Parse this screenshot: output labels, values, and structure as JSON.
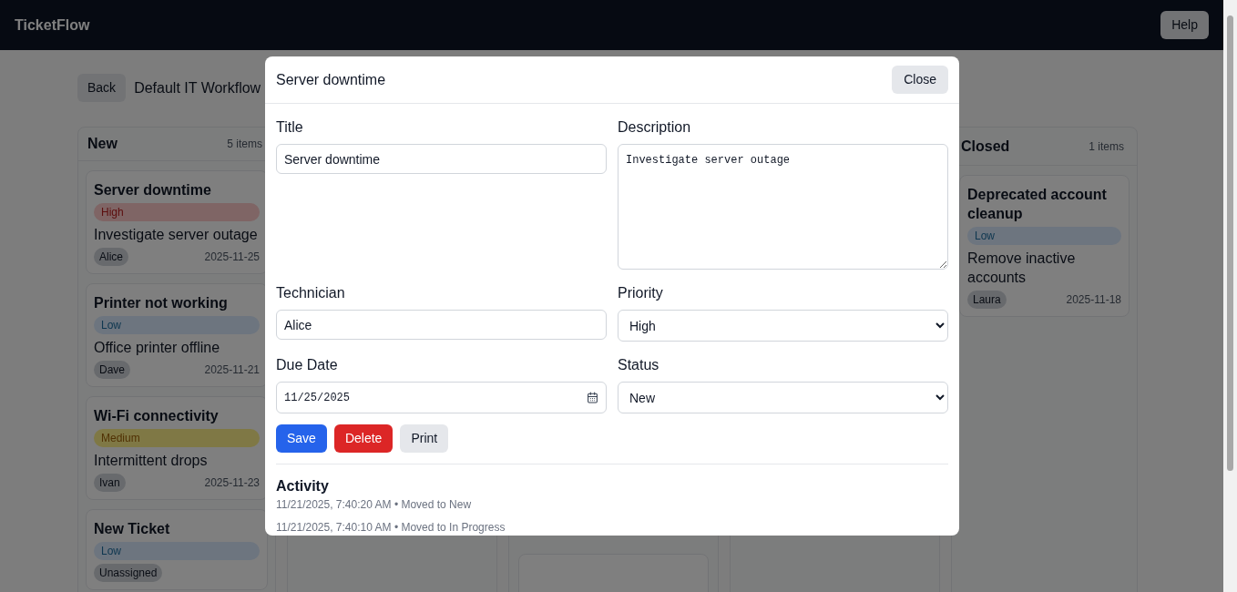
{
  "app": {
    "brand": "TicketFlow",
    "help_button": "Help"
  },
  "toolbar": {
    "back_button": "Back",
    "workflow_title": "Default IT Workflow"
  },
  "board": {
    "columns": [
      {
        "title": "New",
        "count": "5 items",
        "cards": [
          {
            "title": "Server downtime",
            "priority": {
              "label": "High",
              "kind": "high"
            },
            "description": "Investigate server outage",
            "assignee": "Alice",
            "due": "2025-11-25"
          },
          {
            "title": "Printer not working",
            "priority": {
              "label": "Low",
              "kind": "low"
            },
            "description": "Office printer offline",
            "assignee": "Dave",
            "due": "2025-11-21"
          },
          {
            "title": "Wi-Fi connectivity",
            "priority": {
              "label": "Medium",
              "kind": "medium"
            },
            "description": "Intermittent drops",
            "assignee": "Ivan",
            "due": "2025-11-23"
          },
          {
            "title": "New Ticket",
            "priority": {
              "label": "Low",
              "kind": "low"
            },
            "assignee": "Unassigned"
          }
        ]
      },
      {
        "title": "Closed",
        "count": "1 items",
        "cards": [
          {
            "title": "Deprecated account cleanup",
            "priority": {
              "label": "Low",
              "kind": "low"
            },
            "description": "Remove inactive accounts",
            "assignee": "Laura",
            "due": "2025-11-18"
          }
        ]
      }
    ]
  },
  "modal": {
    "title": "Server downtime",
    "close_button": "Close",
    "title_field": {
      "label": "Title",
      "value": "Server downtime"
    },
    "description_field": {
      "label": "Description",
      "value": "Investigate server outage"
    },
    "technician_field": {
      "label": "Technician",
      "value": "Alice"
    },
    "priority_field": {
      "label": "Priority",
      "value": "High"
    },
    "due_date_field": {
      "label": "Due Date",
      "value": "11/25/2025"
    },
    "status_field": {
      "label": "Status",
      "value": "New"
    },
    "buttons": [
      {
        "label": "Save",
        "kind": "primary"
      },
      {
        "label": "Delete",
        "kind": "danger"
      },
      {
        "label": "Print",
        "kind": "secondary"
      }
    ],
    "activity": {
      "heading": "Activity",
      "entries": [
        "11/21/2025, 7:40:20 AM • Moved to New",
        "11/21/2025, 7:40:10 AM • Moved to In Progress"
      ]
    }
  }
}
